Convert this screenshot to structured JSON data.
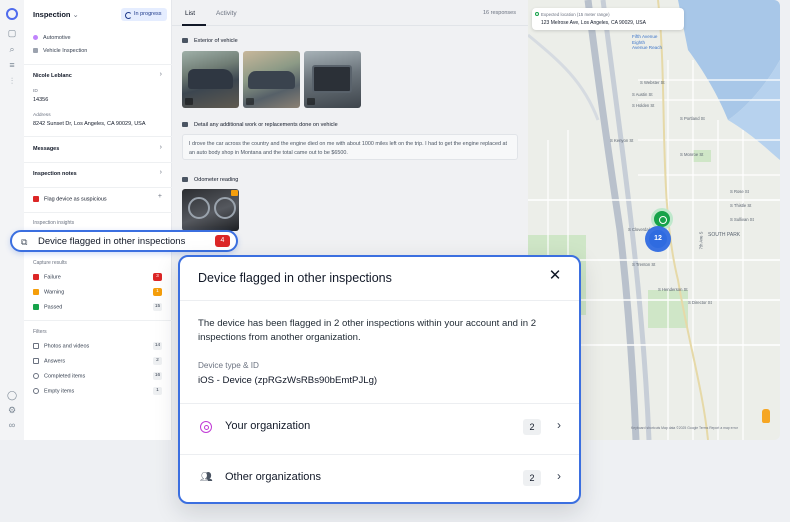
{
  "sidebar": {
    "header": "Inspection",
    "status": "In progress",
    "tags": [
      "Automotive",
      "Vehicle Inspection"
    ],
    "inspector": "Nicole Leblanc",
    "id_label": "ID",
    "id_value": "14356",
    "address_label": "Address",
    "address_value": "8242 Sunset Dr, Los Angeles, CA 90029, USA",
    "messages": "Messages",
    "inspection_notes": "Inspection notes",
    "flag_device": "Flag device as suspicious",
    "insights_label": "Inspection insights",
    "capture_label": "Capture results",
    "capture": [
      {
        "label": "Failure",
        "count": "3",
        "color": "#dc2626"
      },
      {
        "label": "Warning",
        "count": "1",
        "color": "#f59e0b"
      },
      {
        "label": "Passed",
        "count": "15",
        "color": "#16a34a"
      }
    ],
    "filters_label": "Filters",
    "filters": [
      {
        "label": "Photos and videos",
        "count": "14"
      },
      {
        "label": "Answers",
        "count": "2"
      },
      {
        "label": "Completed items",
        "count": "16"
      },
      {
        "label": "Empty items",
        "count": "1"
      }
    ]
  },
  "highlight": {
    "label": "Device flagged in other inspections",
    "count": "4"
  },
  "center": {
    "tabs": [
      "List",
      "Activity"
    ],
    "responses": "16 responses",
    "exterior": "Exterior of vehicle",
    "work_title": "Detail any additional work or replacements done on vehicle",
    "work_text": "I drove the car across the country and the engine died on me with about 1000 miles left on the trip. I had to get the engine replaced at an auto body shop in Montana and the total came out to be $6500.",
    "odometer": "Odometer reading"
  },
  "map": {
    "expected_label": "Expected location (15 meter range)",
    "expected_value": "123 Melrose Ave, Los Angeles, CA 90029, USA",
    "cluster_count": "12",
    "footer": "Keyboard shortcuts   Map data ©2025 Google   Terms   Report a map error"
  },
  "modal": {
    "title": "Device flagged in other inspections",
    "body": "The device has been flagged in 2 other inspections within your account and in 2 inspections from another organization.",
    "device_label": "Device type & ID",
    "device_value": "iOS - Device (zpRGzWsRBs90bEmtPJLg)",
    "rows": [
      {
        "label": "Your organization",
        "count": "2"
      },
      {
        "label": "Other organizations",
        "count": "2"
      }
    ]
  }
}
